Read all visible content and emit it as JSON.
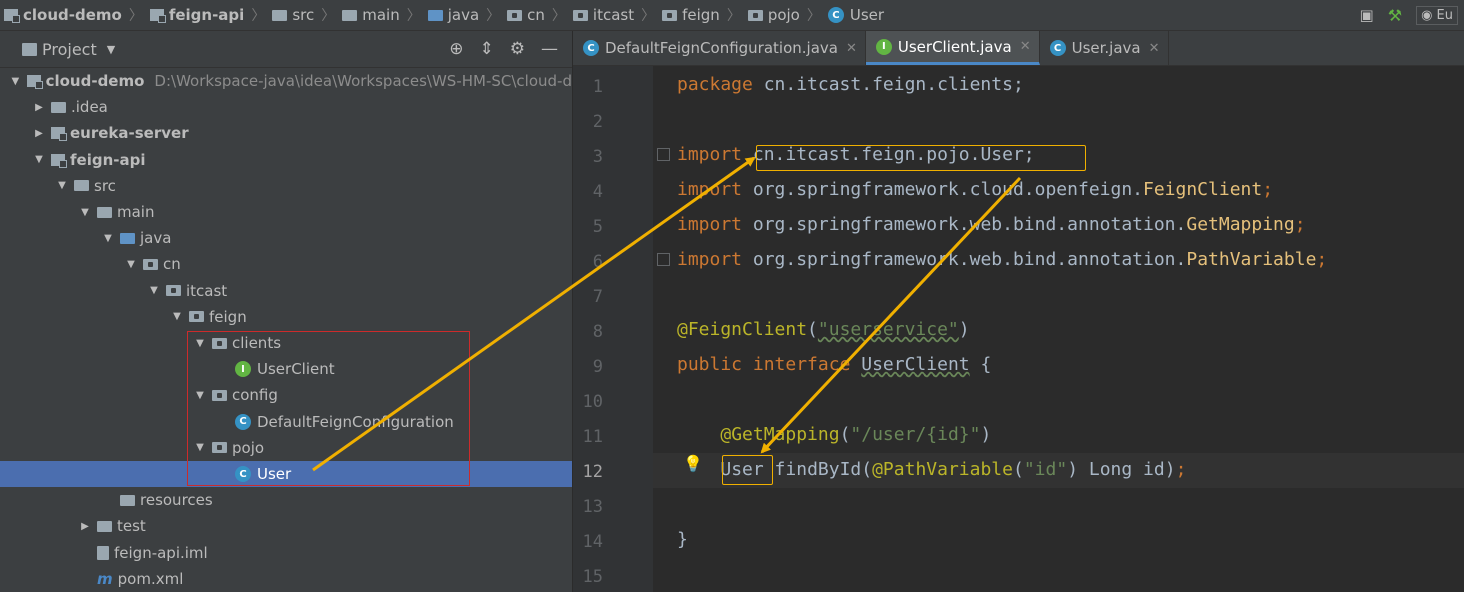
{
  "breadcrumb": [
    "cloud-demo",
    "feign-api",
    "src",
    "main",
    "java",
    "cn",
    "itcast",
    "feign",
    "pojo",
    "User"
  ],
  "topbar": {
    "lang_label": "Eu"
  },
  "project": {
    "title": "Project",
    "root_path": "D:\\Workspace-java\\idea\\Workspaces\\WS-HM-SC\\cloud-d",
    "tree": [
      {
        "label": "cloud-demo",
        "level": 0,
        "icon": "module-icon",
        "expanded": true,
        "bold": true
      },
      {
        "label": ".idea",
        "level": 1,
        "icon": "folder-icon",
        "expanded": false
      },
      {
        "label": "eureka-server",
        "level": 1,
        "icon": "module-icon",
        "expanded": false,
        "bold": true
      },
      {
        "label": "feign-api",
        "level": 1,
        "icon": "module-icon",
        "expanded": true,
        "bold": true
      },
      {
        "label": "src",
        "level": 2,
        "icon": "folder-icon",
        "expanded": true
      },
      {
        "label": "main",
        "level": 3,
        "icon": "folder-icon",
        "expanded": true
      },
      {
        "label": "java",
        "level": 4,
        "icon": "source-folder-icon",
        "expanded": true
      },
      {
        "label": "cn",
        "level": 5,
        "icon": "package-icon",
        "expanded": true
      },
      {
        "label": "itcast",
        "level": 6,
        "icon": "package-icon",
        "expanded": true
      },
      {
        "label": "feign",
        "level": 7,
        "icon": "package-icon",
        "expanded": true
      },
      {
        "label": "clients",
        "level": 8,
        "icon": "package-icon",
        "expanded": true
      },
      {
        "label": "UserClient",
        "level": 9,
        "icon": "interface-icon"
      },
      {
        "label": "config",
        "level": 8,
        "icon": "package-icon",
        "expanded": true
      },
      {
        "label": "DefaultFeignConfiguration",
        "level": 9,
        "icon": "class-icon"
      },
      {
        "label": "pojo",
        "level": 8,
        "icon": "package-icon",
        "expanded": true
      },
      {
        "label": "User",
        "level": 9,
        "icon": "class-icon",
        "selected": true
      },
      {
        "label": "resources",
        "level": 4,
        "icon": "resources-folder-icon"
      },
      {
        "label": "test",
        "level": 3,
        "icon": "folder-icon",
        "expanded": false
      },
      {
        "label": "feign-api.iml",
        "level": 3,
        "icon": "iml-file-icon"
      },
      {
        "label": "pom.xml",
        "level": 3,
        "icon": "maven-icon"
      }
    ]
  },
  "tabs": [
    {
      "label": "DefaultFeignConfiguration.java",
      "icon": "class-icon",
      "active": false
    },
    {
      "label": "UserClient.java",
      "icon": "interface-icon",
      "active": true
    },
    {
      "label": "User.java",
      "icon": "class-icon",
      "active": false
    }
  ],
  "code": {
    "line_numbers": [
      "1",
      "2",
      "3",
      "4",
      "5",
      "6",
      "7",
      "8",
      "9",
      "10",
      "11",
      "12",
      "13",
      "14",
      "15"
    ],
    "current_line": "12",
    "l1_kw": "package",
    "l1_rest": " cn.itcast.feign.clients;",
    "l3_kw": "import",
    "l3_rest": " cn.itcast.feign.pojo.User;",
    "l4_kw": "import",
    "l4_pkg": " org.springframework.cloud.openfeign.",
    "l4_cls": "FeignClient",
    "l4_semi": ";",
    "l5_kw": "import",
    "l5_pkg": " org.springframework.web.bind.annotation.",
    "l5_cls": "GetMapping",
    "l5_semi": ";",
    "l6_kw": "import",
    "l6_pkg": " org.springframework.web.bind.annotation.",
    "l6_cls": "PathVariable",
    "l6_semi": ";",
    "l8_ann": "@FeignClient",
    "l8_open": "(",
    "l8_str": "\"userservice\"",
    "l8_close": ")",
    "l9_kw1": "public",
    "l9_kw2": " interface",
    "l9_name": "UserClient",
    "l9_brace": " {",
    "l11_ann": "@GetMapping",
    "l11_open": "(",
    "l11_str": "\"/user/{id}\"",
    "l11_close": ")",
    "l12_type": "User",
    "l12_method": " findById(",
    "l12_ann": "@PathVariable",
    "l12_open": "(",
    "l12_str": "\"id\"",
    "l12_rest": ") Long id)",
    "l12_semi": ";",
    "l14_brace": "}"
  },
  "colors": {
    "keyword": "#cc7832",
    "annotation": "#bbb529",
    "string": "#6a8759",
    "arrow": "#f0b000",
    "redbox": "#cc2b2b",
    "selection": "#4b6eaf"
  }
}
